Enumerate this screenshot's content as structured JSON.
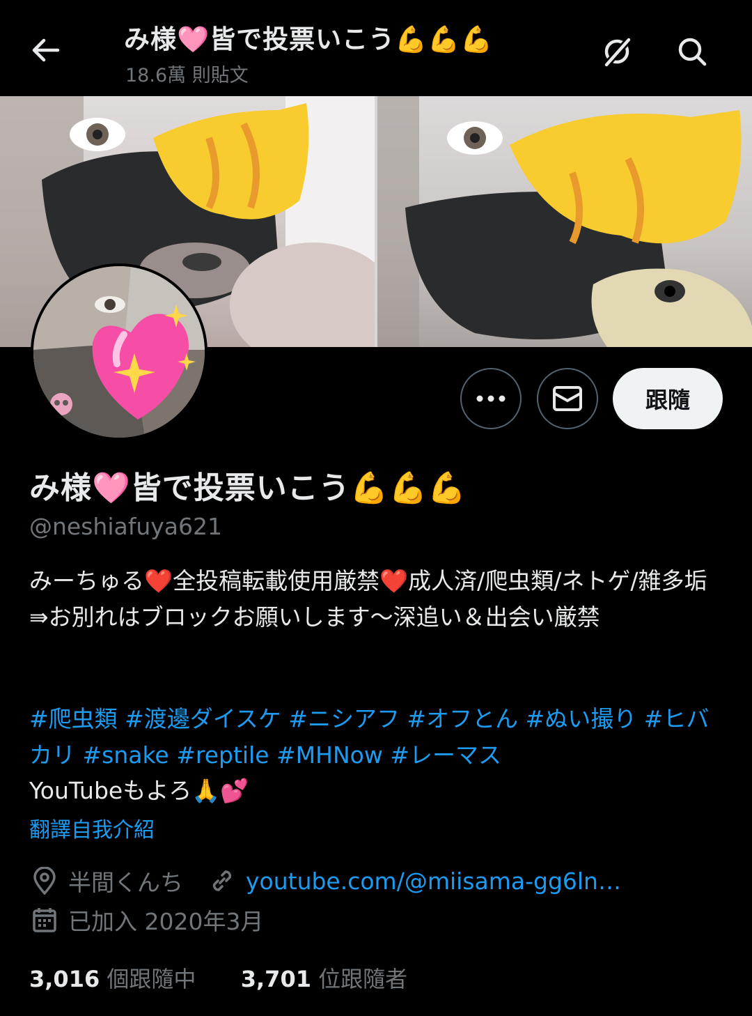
{
  "header": {
    "title": "み様🩷皆で投票いこう💪💪💪",
    "post_count": "18.6萬 則貼文",
    "back_icon": "arrow-left-icon",
    "grok_icon": "grok-icon",
    "search_icon": "search-icon"
  },
  "profile": {
    "display_name": "み様🩷皆で投票いこう💪💪💪",
    "handle": "@neshiafuya621",
    "bio": "みーちゅる❤️全投稿転載使用厳禁❤️成人済/爬虫類/ネトゲ/雑多垢⇛お別れはブロックお願いします〜深追い＆出会い厳禁",
    "hashtags": "#爬虫類 #渡邊ダイスケ #ニシアフ #オフとん #ぬい撮り #ヒバカリ #snake #reptile #MHNow #レーマス",
    "youtube_line": "YouTubeもよろ🙏💕",
    "translate_label": "翻譯自我介紹",
    "location": "半間くんち",
    "website": "youtube.com/@miisama-gg6ln…",
    "joined": "已加入 2020年3月",
    "following_count": "3,016",
    "following_label": "個跟隨中",
    "followers_count": "3,701",
    "followers_label": "位跟隨者"
  },
  "actions": {
    "more_icon": "more-icon",
    "dm_icon": "envelope-icon",
    "follow_label": "跟隨"
  },
  "colors": {
    "background": "#000000",
    "text": "#e7e9ea",
    "muted": "#71767b",
    "link": "#1d9bf0",
    "button_border": "#536471",
    "follow_bg": "#eff3f4"
  }
}
